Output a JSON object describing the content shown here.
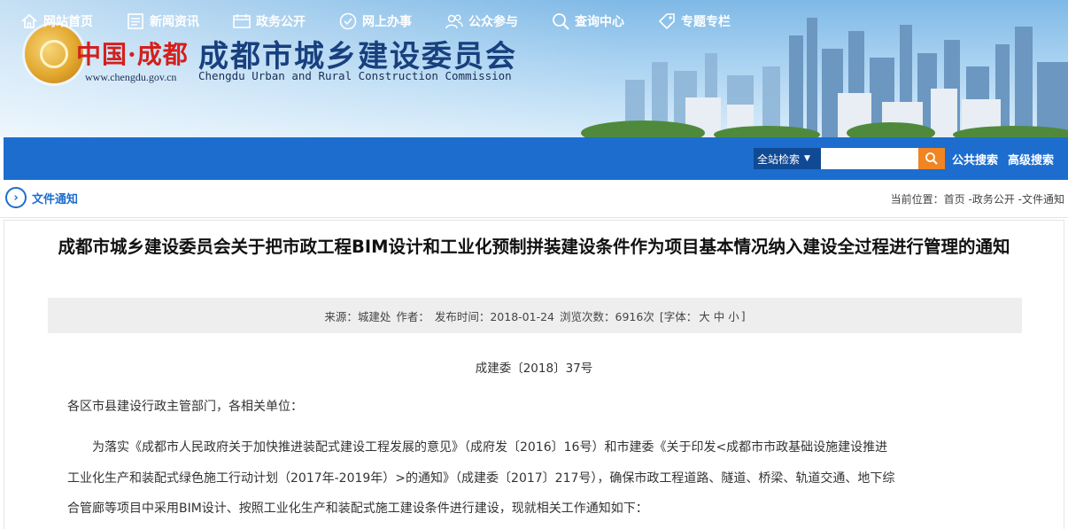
{
  "banner": {
    "site_name": "中国·成都",
    "site_url": "www.chengdu.gov.cn",
    "org_name_cn": "成都市城乡建设委员会",
    "org_name_en": "Chengdu Urban and Rural Construction Commission"
  },
  "nav": {
    "items": [
      {
        "label": "网站首页",
        "icon": "home-icon"
      },
      {
        "label": "新闻资讯",
        "icon": "news-icon"
      },
      {
        "label": "政务公开",
        "icon": "bulletin-icon"
      },
      {
        "label": "网上办事",
        "icon": "service-icon"
      },
      {
        "label": "公众参与",
        "icon": "people-icon"
      },
      {
        "label": "查询中心",
        "icon": "search-icon"
      },
      {
        "label": "专题专栏",
        "icon": "tag-icon"
      }
    ],
    "search_scope": "全站检索",
    "search_placeholder": "",
    "public_search": "公共搜索",
    "advanced_search": "高级搜索"
  },
  "breadcrumb": {
    "section_title": "文件通知",
    "prefix": "当前位置：",
    "path": [
      "首页",
      "政务公开",
      "文件通知"
    ],
    "sep": " -"
  },
  "article": {
    "title": "成都市城乡建设委员会关于把市政工程BIM设计和工业化预制拼装建设条件作为项目基本情况纳入建设全过程进行管理的通知",
    "meta": {
      "source": "来源：城建处",
      "author": "作者：",
      "publish": "发布时间：2018-01-24",
      "views": "浏览次数：6916次",
      "font_prefix": "[字体：",
      "font_large": "大",
      "font_medium": "中",
      "font_small": "小",
      "font_suffix": "]"
    },
    "doc_number": "成建委〔2018〕37号",
    "salutation": "各区市县建设行政主管部门，各相关单位：",
    "para1_line1": "为落实《成都市人民政府关于加快推进装配式建设工程发展的意见》（成府发〔2016〕16号）和市建委《关于印发<成都市市政基础设施建设推进",
    "para1_line2": "工业化生产和装配式绿色施工行动计划（2017年-2019年）>的通知》（成建委〔2017〕217号），确保市政工程道路、隧道、桥梁、轨道交通、地下综",
    "para1_line3": "合管廊等项目中采用BIM设计、按照工业化生产和装配式施工建设条件进行建设，现就相关工作通知如下："
  }
}
